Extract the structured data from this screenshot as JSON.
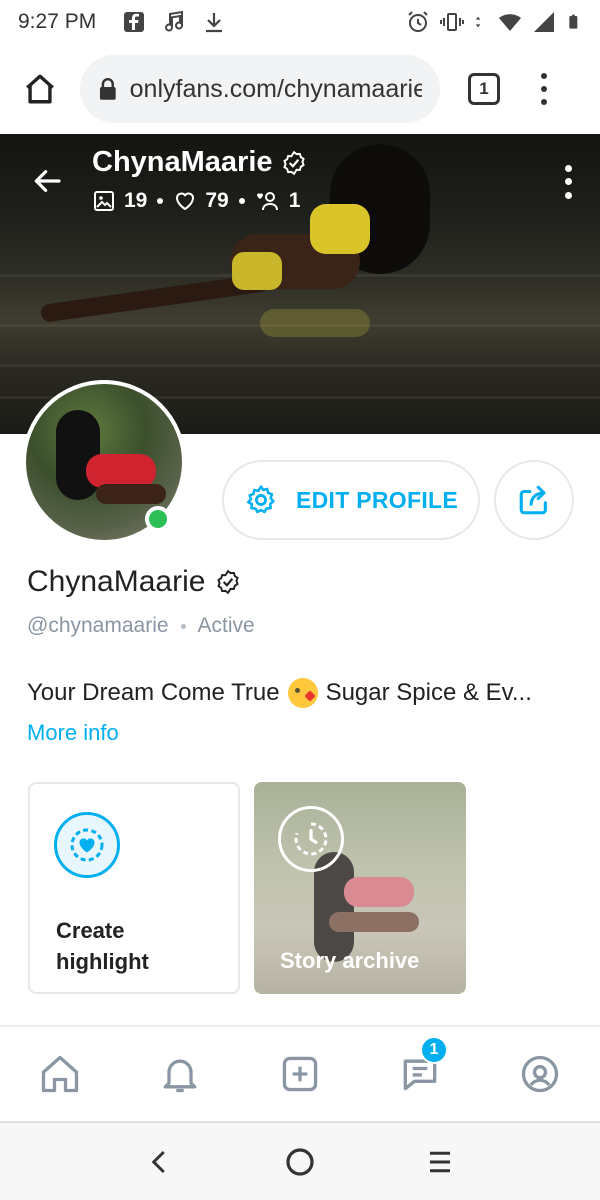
{
  "status_bar": {
    "time": "9:27 PM",
    "left_icons": [
      "facebook-icon",
      "music-note-icon",
      "download-icon"
    ],
    "right_icons": [
      "alarm-icon",
      "vibrate-icon",
      "data-arrows-icon",
      "wifi-icon",
      "signal-icon",
      "battery-icon"
    ]
  },
  "browser": {
    "url": "onlyfans.com/chynamaarie",
    "tab_count": "1"
  },
  "cover": {
    "name": "ChynaMaarie",
    "stats": {
      "photos": "19",
      "likes": "79",
      "fans": "1"
    }
  },
  "profile": {
    "edit_label": "EDIT PROFILE",
    "name": "ChynaMaarie",
    "handle": "@chynamaarie",
    "status": "Active",
    "bio_start": "Your Dream Come True",
    "bio_end": "Sugar Spice & Ev...",
    "more_info": "More info"
  },
  "highlights": {
    "create_line1": "Create",
    "create_line2": "highlight",
    "archive_label": "Story archive"
  },
  "bottom_nav": {
    "messages_badge": "1"
  },
  "colors": {
    "accent": "#00aff0",
    "online": "#2bbf56",
    "muted_text": "#8a96a3",
    "border": "#e3e8ec"
  }
}
